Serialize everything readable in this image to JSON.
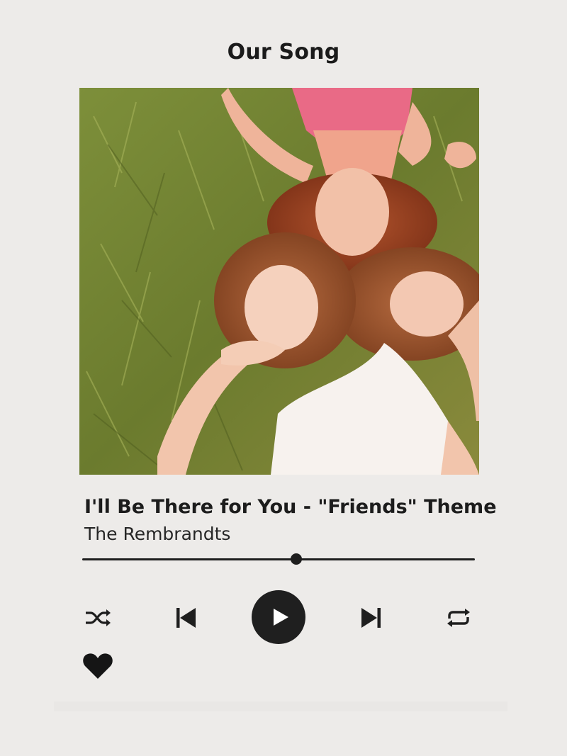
{
  "heading": "Our Song",
  "player": {
    "cover": {
      "icon": "album-cover-photo"
    },
    "song_title": "I'll Be There for You - \"Friends\" Theme",
    "artist": "The Rembrandts",
    "progress": 0.545,
    "controls": {
      "shuffle_icon": "shuffle-icon",
      "previous_icon": "skip-previous-icon",
      "play_icon": "play-icon",
      "next_icon": "skip-next-icon",
      "repeat_icon": "repeat-icon",
      "like_icon": "heart-icon"
    }
  }
}
